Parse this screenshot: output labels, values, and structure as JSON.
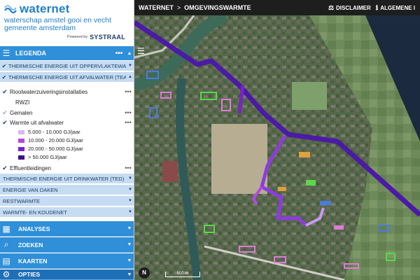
{
  "app": {
    "brand": "waternet",
    "subtitle_line1": "waterschap amstel gooi en vecht",
    "subtitle_line2": "gemeente amsterdam",
    "powered_by": "Powered by",
    "partner": "SYSTRAAL"
  },
  "topbar": {
    "crumb_root": "WATERNET",
    "crumb_separator": ">",
    "crumb_page": "OMGEVINGSWARMTE",
    "disclaimer": "DISCLAIMER",
    "info": "ALGEMENE I",
    "disclaimer_icon": "scale-icon",
    "info_icon": "info-icon"
  },
  "legend": {
    "title": "LEGENDA",
    "dots": "•••",
    "categories": [
      {
        "label": "THERMISCHE ENERGIE UIT OPPERVLAKTEWA...",
        "checked": true
      },
      {
        "label": "THERMISCHE ENERGIE UIT AFVALWATER (TEA)",
        "checked": true
      }
    ],
    "sublayers": [
      {
        "label": "Rioolwaterzuiveringsinstallaties",
        "checked": true,
        "dots": "•••"
      },
      {
        "label": "RWZI"
      },
      {
        "label": "Gemalen",
        "checked": true,
        "dots": "•••"
      },
      {
        "label": "Warmte uit afvalwater",
        "checked": true,
        "dots": "•••"
      },
      {
        "label": "Effluentleidingen",
        "checked": true,
        "dots": "•••"
      }
    ],
    "classes": [
      {
        "label": "5.000 - 10.000 GJ/jaar",
        "color": "#d9b8f0"
      },
      {
        "label": "10.000 - 20.000 GJ/jaar",
        "color": "#b34ad9"
      },
      {
        "label": "20.000 - 50.000 GJ/jaar",
        "color": "#7a22c9"
      },
      {
        "label": "> 50.000 GJ/jaar",
        "color": "#3d0f8c"
      }
    ],
    "more_categories": [
      {
        "label": "THERMISCHE ENERGIE UIT DRINKWATER (TED)"
      },
      {
        "label": "ENERGIE VAN DAKEN"
      },
      {
        "label": "RESTWARMTE"
      },
      {
        "label": "WARMTE- EN KOUDENET"
      }
    ]
  },
  "panels": [
    {
      "label": "ANALYSES",
      "icon": "calculator-icon"
    },
    {
      "label": "ZOEKEN",
      "icon": "search-icon"
    },
    {
      "label": "KAARTEN",
      "icon": "map-icon"
    },
    {
      "label": "OPTIES",
      "icon": "gear-icon"
    }
  ],
  "map": {
    "scale_label": "500 m",
    "compass_label": "N",
    "colors": {
      "pipe_dark": "#4b1aa6",
      "pipe_mid": "#8e3be0",
      "pipe_light": "#c99af0"
    }
  }
}
